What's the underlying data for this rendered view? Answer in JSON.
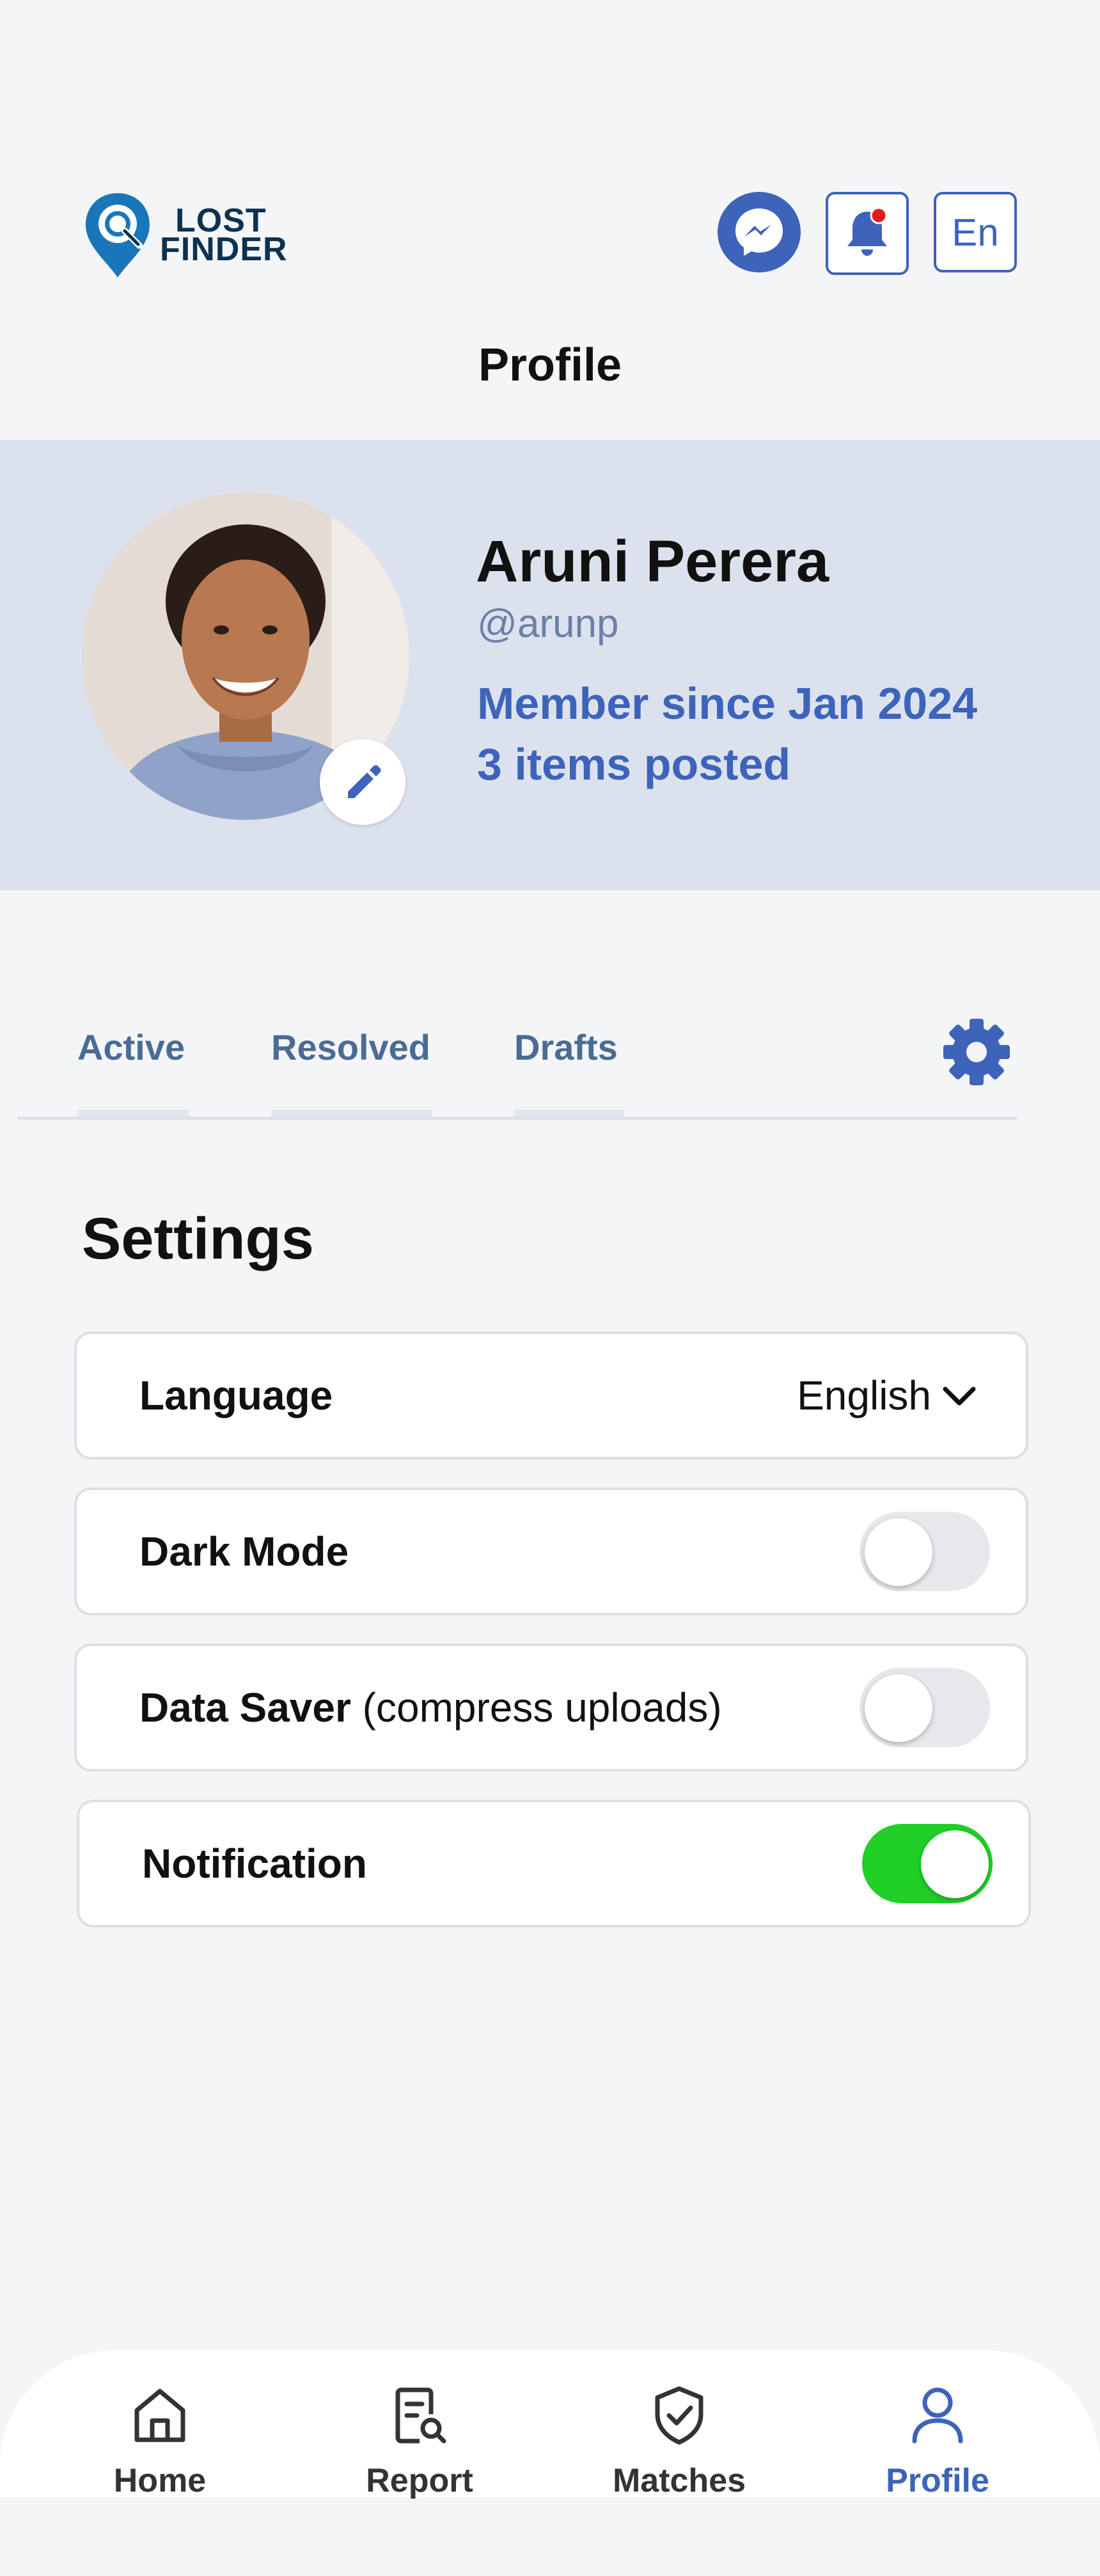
{
  "header": {
    "logo_line1": "LOST",
    "logo_line2": "FINDER",
    "lang_button": "En",
    "page_title": "Profile"
  },
  "profile": {
    "name": "Aruni Perera",
    "handle": "@arunp",
    "member_since": "Member since Jan 2024",
    "items_posted": "3 items posted"
  },
  "tabs": [
    {
      "label": "Active"
    },
    {
      "label": "Resolved"
    },
    {
      "label": "Drafts"
    }
  ],
  "settings": {
    "title": "Settings",
    "language": {
      "label": "Language",
      "value": "English"
    },
    "dark_mode": {
      "label": "Dark Mode",
      "enabled": false
    },
    "data_saver": {
      "label": "Data Saver",
      "sub": "(compress uploads)",
      "enabled": false
    },
    "notification": {
      "label": "Notification",
      "enabled": true
    }
  },
  "nav": [
    {
      "label": "Home",
      "icon": "home-icon"
    },
    {
      "label": "Report",
      "icon": "report-search-icon"
    },
    {
      "label": "Matches",
      "icon": "shield-check-icon"
    },
    {
      "label": "Profile",
      "icon": "user-icon",
      "active": true
    }
  ],
  "colors": {
    "accent": "#3d63bb",
    "toggle_on": "#20cf27",
    "band": "#dce2ed"
  }
}
